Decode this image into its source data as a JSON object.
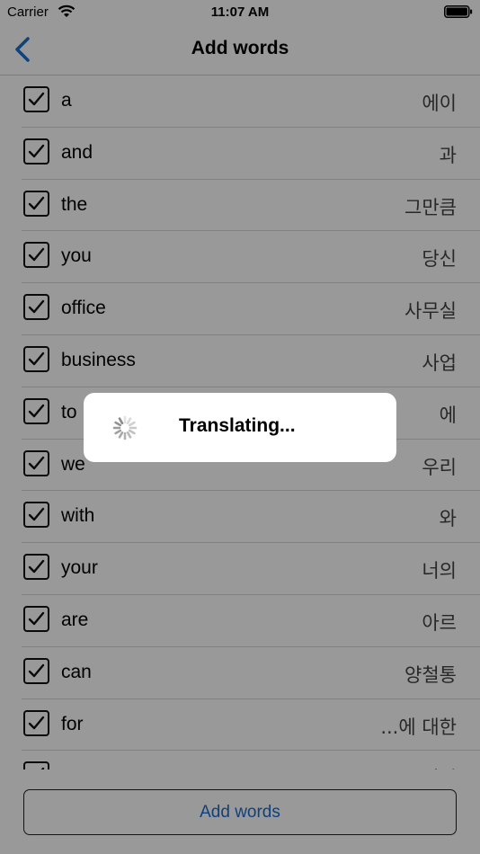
{
  "status_bar": {
    "carrier": "Carrier",
    "time": "11:07 AM"
  },
  "nav": {
    "title": "Add words"
  },
  "words": [
    {
      "en": "a",
      "ko": "에이",
      "checked": true
    },
    {
      "en": "and",
      "ko": "과",
      "checked": true
    },
    {
      "en": "the",
      "ko": "그만큼",
      "checked": true
    },
    {
      "en": "you",
      "ko": "당신",
      "checked": true
    },
    {
      "en": "office",
      "ko": "사무실",
      "checked": true
    },
    {
      "en": "business",
      "ko": "사업",
      "checked": true
    },
    {
      "en": "to",
      "ko": "에",
      "checked": true
    },
    {
      "en": "we",
      "ko": "우리",
      "checked": true
    },
    {
      "en": "with",
      "ko": "와",
      "checked": true
    },
    {
      "en": "your",
      "ko": "너의",
      "checked": true
    },
    {
      "en": "are",
      "ko": "아르",
      "checked": true
    },
    {
      "en": "can",
      "ko": "양철통",
      "checked": true
    },
    {
      "en": "for",
      "ko": "...에 대한",
      "checked": true
    },
    {
      "en": "our",
      "ko": "우리의",
      "checked": true
    }
  ],
  "footer": {
    "add_words_label": "Add words"
  },
  "hud": {
    "message": "Translating..."
  },
  "colors": {
    "accent": "#1a6dd0",
    "overlay": "rgba(0,0,0,0.4)"
  },
  "icons": {
    "back": "chevron-left-icon",
    "spinner": "activity-indicator-icon"
  }
}
